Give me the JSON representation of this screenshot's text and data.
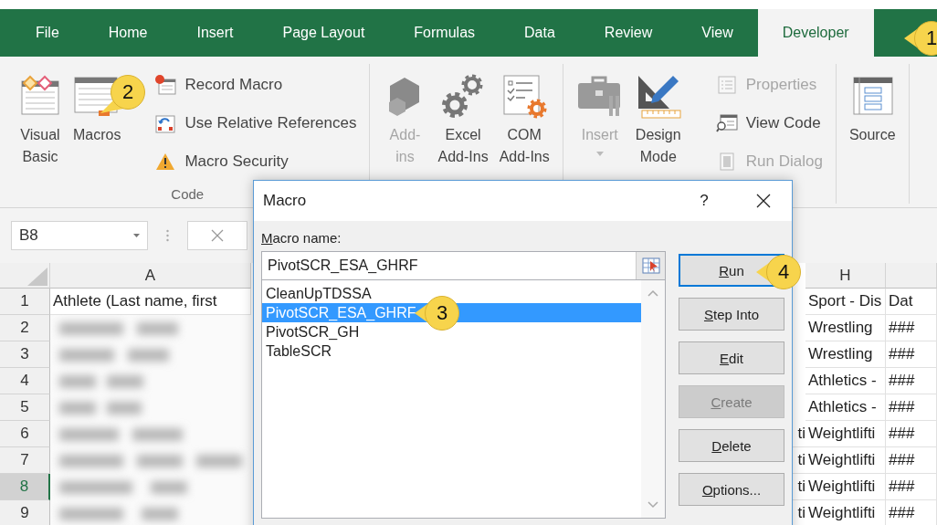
{
  "tabs": [
    {
      "label": "File",
      "selected": false
    },
    {
      "label": "Home",
      "selected": false
    },
    {
      "label": "Insert",
      "selected": false
    },
    {
      "label": "Page Layout",
      "selected": false
    },
    {
      "label": "Formulas",
      "selected": false
    },
    {
      "label": "Data",
      "selected": false
    },
    {
      "label": "Review",
      "selected": false
    },
    {
      "label": "View",
      "selected": false
    },
    {
      "label": "Developer",
      "selected": true
    }
  ],
  "ribbon": {
    "groups": [
      {
        "label": "Code",
        "items": [
          {
            "kind": "large",
            "lines": [
              "Visual",
              "Basic"
            ],
            "disabled": false
          },
          {
            "kind": "large",
            "lines": [
              "Macros"
            ],
            "disabled": false
          },
          {
            "kind": "small",
            "lines": [
              "Record Macro"
            ],
            "disabled": false
          },
          {
            "kind": "small",
            "lines": [
              "Use Relative References"
            ],
            "disabled": false
          },
          {
            "kind": "small",
            "lines": [
              "Macro Security"
            ],
            "disabled": false
          }
        ]
      },
      {
        "items": [
          {
            "kind": "large",
            "lines": [
              "Add-",
              "ins"
            ],
            "disabled": true
          },
          {
            "kind": "large",
            "lines": [
              "Excel",
              "Add-Ins"
            ],
            "disabled": false
          },
          {
            "kind": "large",
            "lines": [
              "COM",
              "Add-Ins"
            ],
            "disabled": false
          }
        ]
      },
      {
        "items": [
          {
            "kind": "large",
            "lines": [
              "Insert"
            ],
            "disabled": true,
            "dropdown": true
          },
          {
            "kind": "large",
            "lines": [
              "Design",
              "Mode"
            ],
            "disabled": false
          },
          {
            "kind": "small",
            "lines": [
              "Properties"
            ],
            "disabled": true
          },
          {
            "kind": "small",
            "lines": [
              "View Code"
            ],
            "disabled": false
          },
          {
            "kind": "small",
            "lines": [
              "Run Dialog"
            ],
            "disabled": true
          }
        ]
      },
      {
        "items": [
          {
            "kind": "large",
            "lines": [
              "Source"
            ],
            "disabled": false
          }
        ]
      }
    ]
  },
  "formula_bar": {
    "name_box": "B8"
  },
  "sheet": {
    "columns": [
      {
        "label": "A"
      },
      {
        "label": "H"
      }
    ],
    "rows": [
      {
        "header": "1",
        "selected": false,
        "col_a": "Athlete (Last name, first",
        "col_h": "Sport - Dis",
        "col_i": "Dat"
      },
      {
        "header": "2",
        "selected": false,
        "col_h": "Wrestling",
        "col_i": "###"
      },
      {
        "header": "3",
        "selected": false,
        "col_h": "Wrestling",
        "col_i": "###"
      },
      {
        "header": "4",
        "selected": false,
        "col_h": "Athletics -",
        "col_i": "###"
      },
      {
        "header": "5",
        "selected": false,
        "col_h": "Athletics -",
        "col_i": "###"
      },
      {
        "header": "6",
        "selected": false,
        "col_g": "ti",
        "col_h": "Weightlifti",
        "col_i": "###"
      },
      {
        "header": "7",
        "selected": false,
        "col_g": "ti",
        "col_h": "Weightlifti",
        "col_i": "###"
      },
      {
        "header": "8",
        "selected": true,
        "col_g": "ti",
        "col_h": "Weightlifti",
        "col_i": "###"
      },
      {
        "header": "9",
        "selected": false,
        "col_g": "ti",
        "col_h": "Weightlifti",
        "col_i": "###"
      }
    ]
  },
  "dialog": {
    "title": "Macro",
    "help": "?",
    "name_label": "Macro name:",
    "name_value": "PivotSCR_ESA_GHRF",
    "macros": [
      {
        "label": "CleanUpTDSSA",
        "selected": false
      },
      {
        "label": "PivotSCR_ESA_GHRF",
        "selected": true
      },
      {
        "label": "PivotSCR_GH",
        "selected": false
      },
      {
        "label": "TableSCR",
        "selected": false
      }
    ],
    "buttons": [
      {
        "label": "Run",
        "default": true,
        "disabled": false
      },
      {
        "label": "Step Into",
        "default": false,
        "disabled": false
      },
      {
        "label": "Edit",
        "default": false,
        "disabled": false
      },
      {
        "label": "Create",
        "default": false,
        "disabled": true
      },
      {
        "label": "Delete",
        "default": false,
        "disabled": false
      },
      {
        "label": "Options...",
        "default": false,
        "disabled": false
      }
    ]
  },
  "callouts": [
    {
      "number": "1"
    },
    {
      "number": "2"
    },
    {
      "number": "3"
    },
    {
      "number": "4"
    }
  ]
}
